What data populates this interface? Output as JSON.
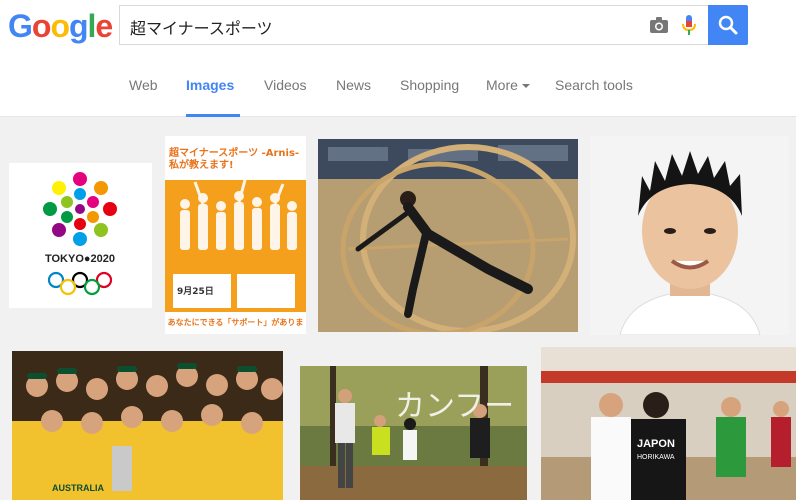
{
  "search": {
    "query": "超マイナースポーツ"
  },
  "logo": {
    "letters": [
      "G",
      "o",
      "o",
      "g",
      "l",
      "e"
    ],
    "colors": [
      "#4285f4",
      "#ea4335",
      "#fbbc05",
      "#4285f4",
      "#34a853",
      "#ea4335"
    ]
  },
  "nav": {
    "tabs": [
      "Web",
      "Images",
      "Videos",
      "News",
      "Shopping",
      "More",
      "Search tools"
    ],
    "active": "Images"
  },
  "images": {
    "tokyo_label": "TOKYO●2020",
    "poster_title": "超マイナースポーツ -Arnis-\n私が教えます!",
    "poster_date": "9月25日",
    "poster_footer": "あなたにできる「サポート」があります!",
    "jersey_text": "JAPON",
    "jersey_name": "HORIKAWA",
    "forest_text": "カンフー カンディ",
    "team_text": "AUSTRALIA"
  },
  "colors": {
    "accent": "#4285f4",
    "poster_orange": "#f5a01d"
  },
  "icons": [
    "camera-icon",
    "microphone-icon",
    "search-icon"
  ]
}
